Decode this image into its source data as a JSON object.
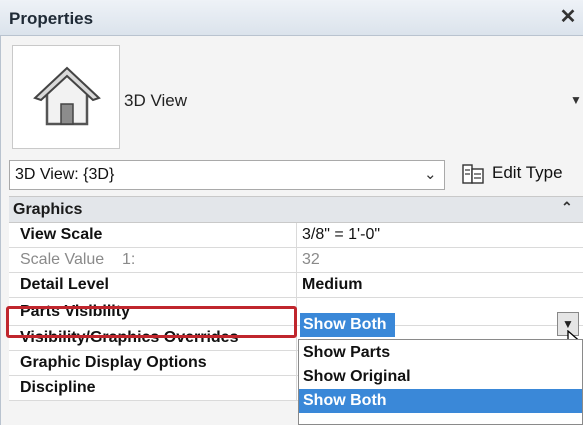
{
  "window": {
    "title": "Properties"
  },
  "type_selector": {
    "name": "3D View"
  },
  "instance_selector": {
    "value": "3D View: {3D}"
  },
  "edit_type": {
    "label": "Edit Type"
  },
  "section": {
    "label": "Graphics"
  },
  "rows": [
    {
      "name": "View Scale",
      "value": "3/8\" = 1'-0\""
    },
    {
      "name": "Scale Value    1:",
      "value": "32"
    },
    {
      "name": "Detail Level",
      "value": "Medium"
    },
    {
      "name": "Parts Visibility",
      "value": "Show Both"
    },
    {
      "name": "Visibility/Graphics Overrides",
      "value": ""
    },
    {
      "name": "Graphic Display Options",
      "value": ""
    },
    {
      "name": "Discipline",
      "value": ""
    }
  ],
  "dropdown": {
    "options": [
      "Show Parts",
      "Show Original",
      "Show Both"
    ],
    "selected": "Show Both"
  },
  "colors": {
    "selection": "#3a88d8",
    "highlight": "#c0262d"
  }
}
